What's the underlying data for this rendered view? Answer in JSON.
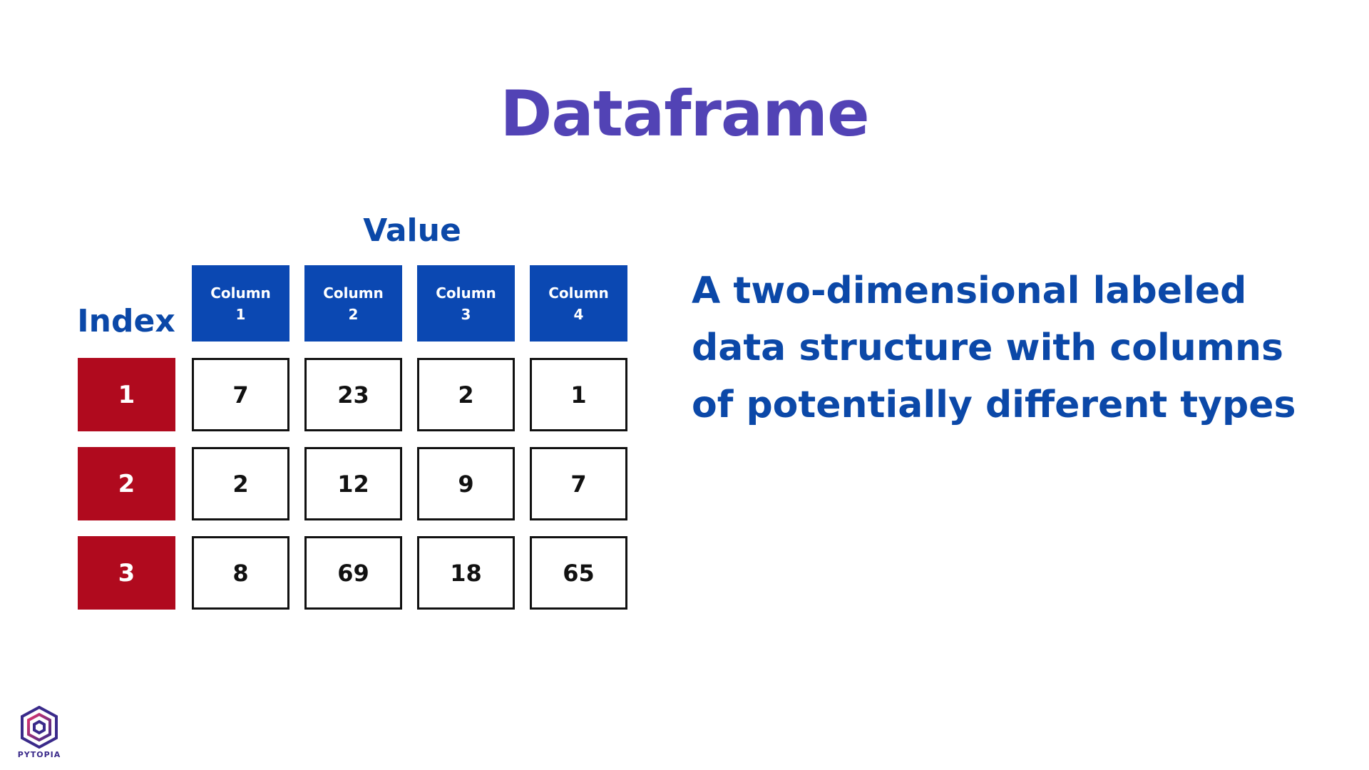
{
  "title": "Dataframe",
  "value_label": "Value",
  "index_label": "Index",
  "columns": [
    {
      "line1": "Column",
      "line2": "1"
    },
    {
      "line1": "Column",
      "line2": "2"
    },
    {
      "line1": "Column",
      "line2": "3"
    },
    {
      "line1": "Column",
      "line2": "4"
    }
  ],
  "rows": [
    {
      "index": "1",
      "cells": [
        "7",
        "23",
        "2",
        "1"
      ]
    },
    {
      "index": "2",
      "cells": [
        "2",
        "12",
        "9",
        "7"
      ]
    },
    {
      "index": "3",
      "cells": [
        "8",
        "69",
        "18",
        "65"
      ]
    }
  ],
  "description": "A two-dimensional labeled data structure with columns of potentially different types",
  "logo": {
    "text": "PYTOPIA",
    "icon": "pytopia-hexagon-icon"
  },
  "colors": {
    "title": "#5243b5",
    "accent_blue": "#0b48b2",
    "index_red": "#b00a1e",
    "cell_border": "#111111"
  }
}
